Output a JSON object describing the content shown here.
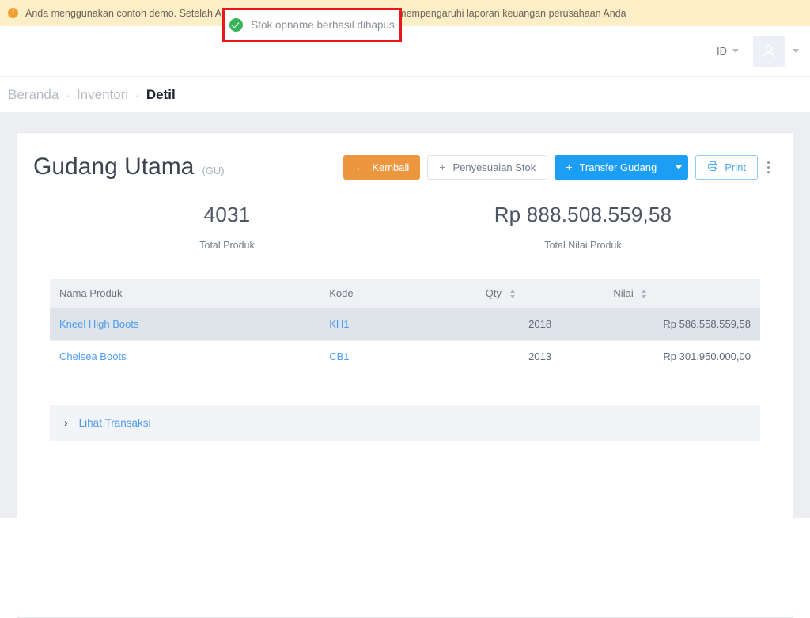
{
  "banner": {
    "icon": "warning-circle-icon",
    "text": "Anda menggunakan contoh demo. Setelah Anda berhasil dihapus data ini tidak akan mempengaruhi laporan keuangan perusahaan Anda"
  },
  "toast": {
    "icon": "check-circle-icon",
    "message": "Stok opname berhasil dihapus"
  },
  "topnav": {
    "language": "ID",
    "avatar_icon": "user-avatar-icon",
    "lang_caret_icon": "chevron-down-icon",
    "avatar_caret_icon": "chevron-down-icon"
  },
  "breadcrumb": {
    "items": [
      {
        "label": "Beranda",
        "active": false
      },
      {
        "label": "Inventori",
        "active": false
      },
      {
        "label": "Detil",
        "active": true
      }
    ],
    "separator": "·"
  },
  "warehouse": {
    "name": "Gudang Utama",
    "code": "(GU)"
  },
  "actions": {
    "back": {
      "label": "Kembali",
      "icon": "arrow-left-icon",
      "glyph": "←",
      "color": "#ec9740"
    },
    "stock_adjustment": {
      "label": "Penyesuaian Stok",
      "icon": "plus-icon",
      "glyph": "+"
    },
    "transfer": {
      "label": "Transfer Gudang",
      "icon": "plus-icon",
      "glyph": "+",
      "color": "#1c9ef5"
    },
    "transfer_dropdown_icon": "chevron-down-icon",
    "print": {
      "label": "Print",
      "icon": "printer-icon"
    },
    "more_icon": "kebab-menu-icon"
  },
  "stats": [
    {
      "value": "4031",
      "label": "Total Produk"
    },
    {
      "value": "Rp 888.508.559,58",
      "label": "Total Nilai Produk"
    }
  ],
  "table": {
    "columns": [
      {
        "label": "Nama Produk",
        "sortable": false
      },
      {
        "label": "Kode",
        "sortable": false
      },
      {
        "label": "Qty",
        "sortable": true
      },
      {
        "label": "Nilai",
        "sortable": true
      }
    ],
    "rows": [
      {
        "name": "Kneel High Boots",
        "code": "KH1",
        "qty": "2018",
        "value": "Rp 586.558.559,58",
        "highlighted": true
      },
      {
        "name": "Chelsea Boots",
        "code": "CB1",
        "qty": "2013",
        "value": "Rp 301.950.000,00",
        "highlighted": false
      }
    ]
  },
  "accordion": {
    "label": "Lihat Transaksi",
    "icon": "chevron-right-icon",
    "glyph": "›"
  }
}
